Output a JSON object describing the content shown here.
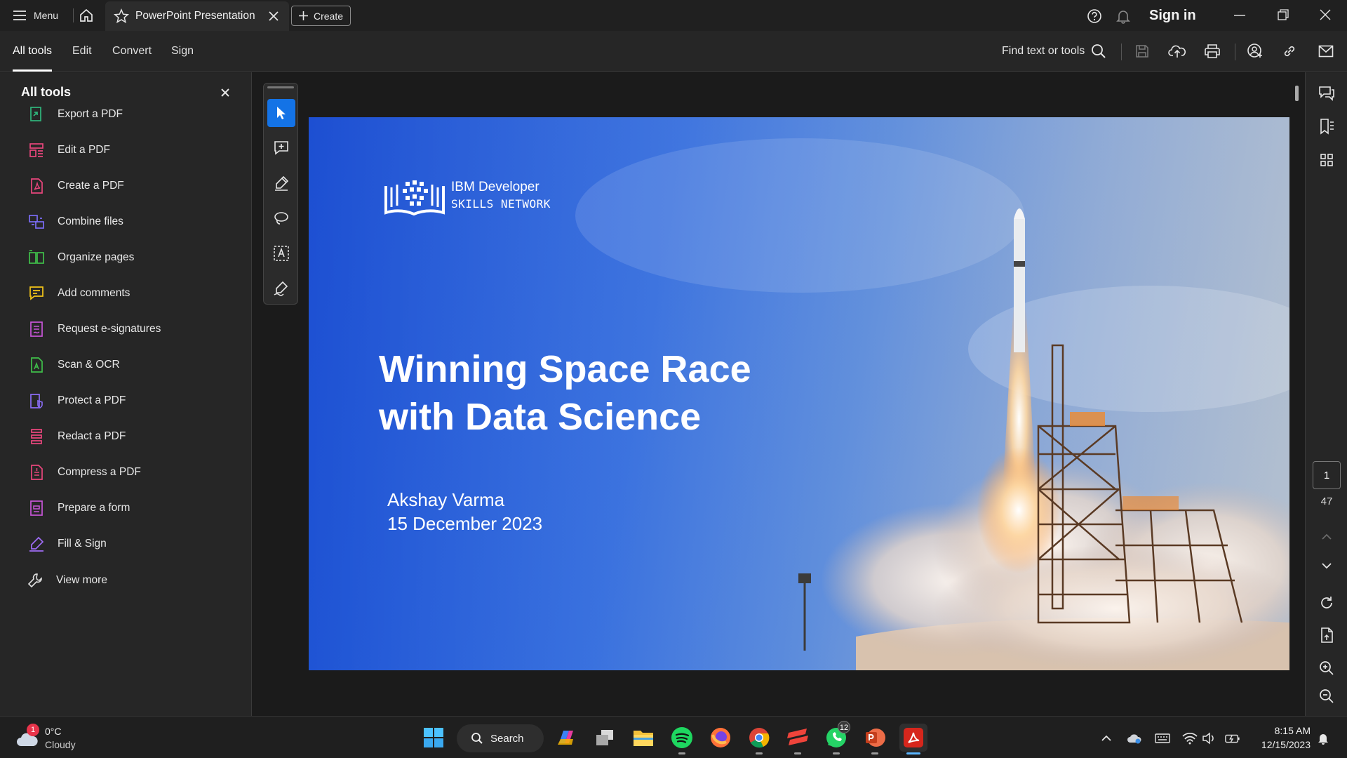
{
  "titlebar": {
    "menu_label": "Menu",
    "tab_title": "PowerPoint Presentation",
    "create_label": "Create",
    "sign_in_label": "Sign in"
  },
  "toolbar": {
    "tabs": [
      {
        "label": "All tools",
        "active": true
      },
      {
        "label": "Edit",
        "active": false
      },
      {
        "label": "Convert",
        "active": false
      },
      {
        "label": "Sign",
        "active": false
      }
    ],
    "find_label": "Find text or tools"
  },
  "left_panel": {
    "title": "All tools",
    "items": [
      {
        "label": "Export a PDF",
        "icon": "export-pdf-icon",
        "color": "#2fb67c"
      },
      {
        "label": "Edit a PDF",
        "icon": "edit-pdf-icon",
        "color": "#e8467c"
      },
      {
        "label": "Create a PDF",
        "icon": "create-pdf-icon",
        "color": "#e8467c"
      },
      {
        "label": "Combine files",
        "icon": "combine-files-icon",
        "color": "#7b6cf5"
      },
      {
        "label": "Organize pages",
        "icon": "organize-pages-icon",
        "color": "#3fbf4a"
      },
      {
        "label": "Add comments",
        "icon": "add-comments-icon",
        "color": "#f4c518"
      },
      {
        "label": "Request e-signatures",
        "icon": "request-esignatures-icon",
        "color": "#c855d8"
      },
      {
        "label": "Scan & OCR",
        "icon": "scan-ocr-icon",
        "color": "#3fbf4a"
      },
      {
        "label": "Protect a PDF",
        "icon": "protect-pdf-icon",
        "color": "#8a6cf5"
      },
      {
        "label": "Redact a PDF",
        "icon": "redact-pdf-icon",
        "color": "#e8467c"
      },
      {
        "label": "Compress a PDF",
        "icon": "compress-pdf-icon",
        "color": "#e8467c"
      },
      {
        "label": "Prepare a form",
        "icon": "prepare-form-icon",
        "color": "#c855d8"
      },
      {
        "label": "Fill & Sign",
        "icon": "fill-sign-icon",
        "color": "#9f6cf5"
      },
      {
        "label": "View more",
        "icon": "wrench-icon",
        "color": "#e0e0e0"
      }
    ]
  },
  "slide": {
    "logo_line1": "IBM Developer",
    "logo_line2": "SKILLS NETWORK",
    "title_line1": "Winning Space Race",
    "title_line2": "with Data Science",
    "author": "Akshay Varma",
    "date": "15 December 2023"
  },
  "navigation": {
    "current_page": "1",
    "total_pages": "47"
  },
  "taskbar": {
    "weather_temp": "0°C",
    "weather_desc": "Cloudy",
    "weather_badge": "1",
    "search_label": "Search",
    "whatsapp_badge": "12",
    "time": "8:15 AM",
    "date": "12/15/2023"
  },
  "colors": {
    "accent": "#1473e6",
    "acrobat_red": "#d6261c",
    "slide_blue": "#2462dc"
  }
}
